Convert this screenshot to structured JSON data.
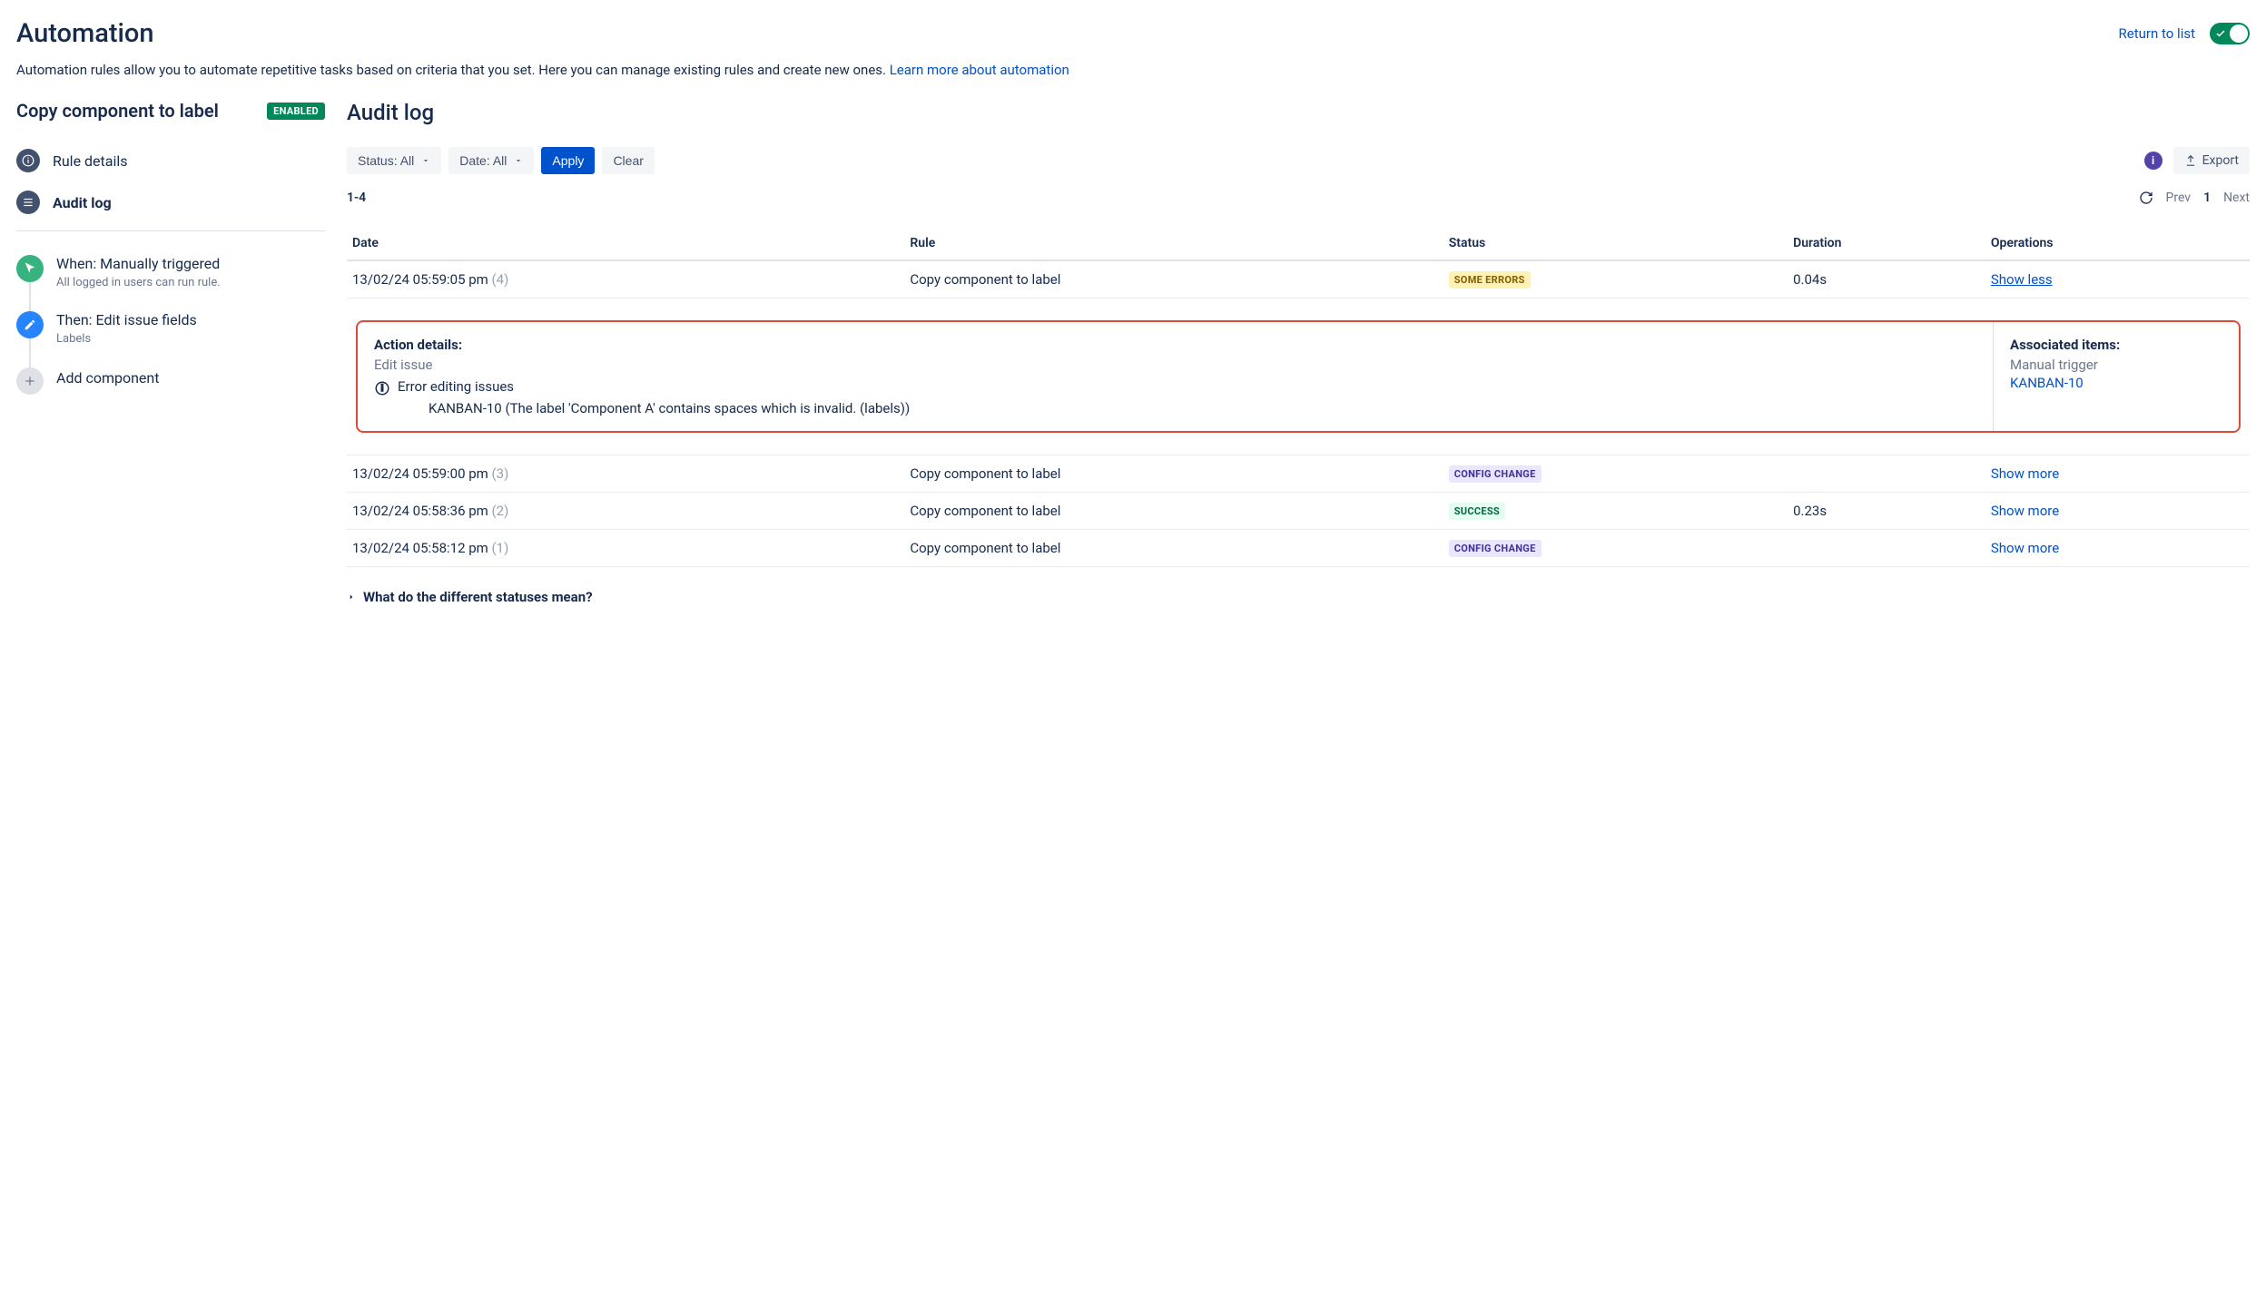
{
  "header": {
    "title": "Automation",
    "return_label": "Return to list",
    "description": "Automation rules allow you to automate repetitive tasks based on criteria that you set. Here you can manage existing rules and create new ones.",
    "learn_more": "Learn more about automation"
  },
  "rule": {
    "name": "Copy component to label",
    "status_label": "ENABLED"
  },
  "nav": {
    "rule_details": "Rule details",
    "audit_log": "Audit log"
  },
  "steps": {
    "trigger": {
      "title": "When: Manually triggered",
      "desc": "All logged in users can run rule."
    },
    "action": {
      "title": "Then: Edit issue fields",
      "desc": "Labels"
    },
    "add": {
      "title": "Add component"
    }
  },
  "audit": {
    "title": "Audit log",
    "status_filter": "Status: All",
    "date_filter": "Date: All",
    "apply": "Apply",
    "clear": "Clear",
    "export": "Export",
    "range": "1-4",
    "prev": "Prev",
    "page": "1",
    "next": "Next",
    "cols": {
      "date": "Date",
      "rule": "Rule",
      "status": "Status",
      "duration": "Duration",
      "operations": "Operations"
    },
    "rows": [
      {
        "date": "13/02/24 05:59:05 pm",
        "count": "(4)",
        "rule": "Copy component to label",
        "status": "SOME ERRORS",
        "status_kind": "some-errors",
        "duration": "0.04s",
        "op": "Show less",
        "op_underline": true
      },
      {
        "date": "13/02/24 05:59:00 pm",
        "count": "(3)",
        "rule": "Copy component to label",
        "status": "CONFIG CHANGE",
        "status_kind": "config",
        "duration": "",
        "op": "Show more",
        "op_underline": false
      },
      {
        "date": "13/02/24 05:58:36 pm",
        "count": "(2)",
        "rule": "Copy component to label",
        "status": "SUCCESS",
        "status_kind": "success",
        "duration": "0.23s",
        "op": "Show more",
        "op_underline": false
      },
      {
        "date": "13/02/24 05:58:12 pm",
        "count": "(1)",
        "rule": "Copy component to label",
        "status": "CONFIG CHANGE",
        "status_kind": "config",
        "duration": "",
        "op": "Show more",
        "op_underline": false
      }
    ],
    "detail": {
      "action_details_h": "Action details:",
      "edit_issue": "Edit issue",
      "error_heading": "Error editing issues",
      "error_msg": "KANBAN-10 (The label 'Component A' contains spaces which is invalid. (labels))",
      "assoc_h": "Associated items:",
      "assoc_sub": "Manual trigger",
      "assoc_link": "KANBAN-10"
    },
    "faq": "What do the different statuses mean?"
  }
}
